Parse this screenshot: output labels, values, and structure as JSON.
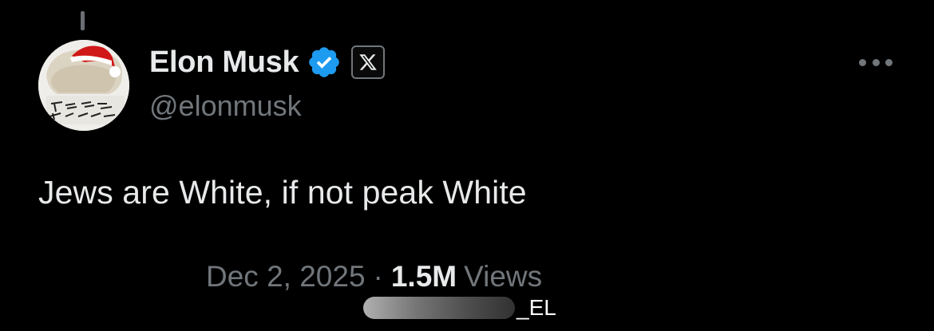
{
  "author": {
    "display_name": "Elon Musk",
    "handle": "@elonmusk",
    "verified": true,
    "verified_color": "#1d9bf0",
    "affiliation_badge": "x-logo-icon"
  },
  "tweet": {
    "text": "Jews are White, if not peak White",
    "date": "Dec 2, 2025",
    "separator": "·",
    "views_count": "1.5M",
    "views_label": "Views"
  },
  "watermark": {
    "text": "_EL"
  },
  "colors": {
    "background": "#000000",
    "primary_text": "#e7e9ea",
    "secondary_text": "#71767b",
    "accent": "#1d9bf0"
  }
}
